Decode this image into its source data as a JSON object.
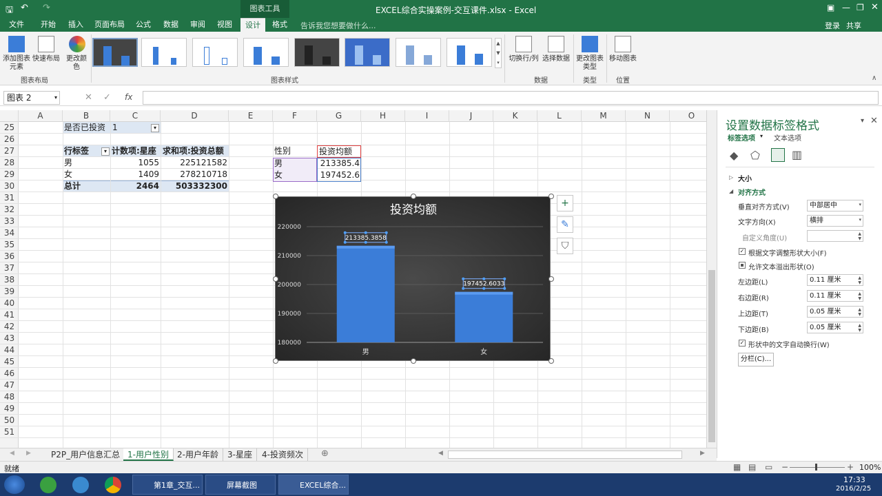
{
  "window": {
    "title": "EXCEL综合实操案例-交互课件.xlsx - Excel",
    "context_tab": "图表工具"
  },
  "ribbon": {
    "tabs": [
      "文件",
      "开始",
      "插入",
      "页面布局",
      "公式",
      "数据",
      "审阅",
      "视图",
      "设计",
      "格式"
    ],
    "active_tab": "设计",
    "tell_me": "告诉我您想要做什么...",
    "login": "登录",
    "share": "共享",
    "add_element": "添加图表元素",
    "quick_layout": "快速布局",
    "change_color": "更改颜色",
    "switch_row_col": "切换行/列",
    "select_data": "选择数据",
    "change_type": "更改图表类型",
    "move_chart": "移动图表",
    "groups": {
      "layout": "图表布局",
      "styles": "图表样式",
      "data": "数据",
      "type": "类型",
      "location": "位置"
    }
  },
  "formula": {
    "namebox": "图表 2",
    "fx": "fx",
    "value": ""
  },
  "columns": [
    "A",
    "B",
    "C",
    "D",
    "E",
    "F",
    "G",
    "H",
    "I",
    "J",
    "K",
    "L",
    "M",
    "N",
    "O"
  ],
  "rows": [
    "25",
    "26",
    "27",
    "28",
    "29",
    "30",
    "31",
    "32",
    "33",
    "34",
    "35",
    "36",
    "37",
    "38",
    "39",
    "40",
    "41",
    "42",
    "43",
    "44",
    "45",
    "46",
    "47",
    "48",
    "49",
    "50",
    "51"
  ],
  "pivot": {
    "filter_label": "是否已投资",
    "filter_value": "1",
    "headers": [
      "行标签",
      "计数项:星座",
      "求和项:投资总额"
    ],
    "rows": [
      [
        "男",
        "1055",
        "225121582"
      ],
      [
        "女",
        "1409",
        "278210718"
      ]
    ],
    "total": [
      "总计",
      "2464",
      "503332300"
    ]
  },
  "table2": {
    "headers": [
      "性别",
      "投资均额"
    ],
    "rows": [
      [
        "男",
        "213385.4"
      ],
      [
        "女",
        "197452.6"
      ]
    ]
  },
  "chart_data": {
    "type": "bar",
    "title": "投资均额",
    "categories": [
      "男",
      "女"
    ],
    "values": [
      213385.3858,
      197452.6033
    ],
    "data_labels": [
      "213385.3858",
      "197452.6033"
    ],
    "ylim": [
      180000,
      220000
    ],
    "yticks": [
      "220000",
      "210000",
      "200000",
      "190000",
      "180000"
    ],
    "grid": true,
    "bar_color": "#3b7dd8"
  },
  "pane": {
    "title": "设置数据标签格式",
    "tab1": "标签选项",
    "tab2": "文本选项",
    "section_size": "大小",
    "section_align": "对齐方式",
    "fields": [
      {
        "label": "垂直对齐方式(V)",
        "value": "中部居中"
      },
      {
        "label": "文字方向(X)",
        "value": "横排"
      },
      {
        "label": "自定义角度(U)",
        "value": ""
      }
    ],
    "check1": "根据文字调整形状大小(F)",
    "check2": "允许文本溢出形状(O)",
    "margins": [
      {
        "label": "左边距(L)",
        "value": "0.11 厘米"
      },
      {
        "label": "右边距(R)",
        "value": "0.11 厘米"
      },
      {
        "label": "上边距(T)",
        "value": "0.05 厘米"
      },
      {
        "label": "下边距(B)",
        "value": "0.05 厘米"
      }
    ],
    "check3": "形状中的文字自动换行(W)",
    "columns_btn": "分栏(C)..."
  },
  "sheets": [
    "P2P_用户信息汇总",
    "1-用户性别",
    "2-用户年龄",
    "3-星座",
    "4-投资频次"
  ],
  "active_sheet": "1-用户性别",
  "status": {
    "ready": "就绪",
    "zoom": "100%"
  },
  "taskbar": {
    "items": [
      "第1章_交互...",
      "屏幕截图",
      "EXCEL综合..."
    ],
    "time": "17:33",
    "date": "2016/2/25"
  }
}
